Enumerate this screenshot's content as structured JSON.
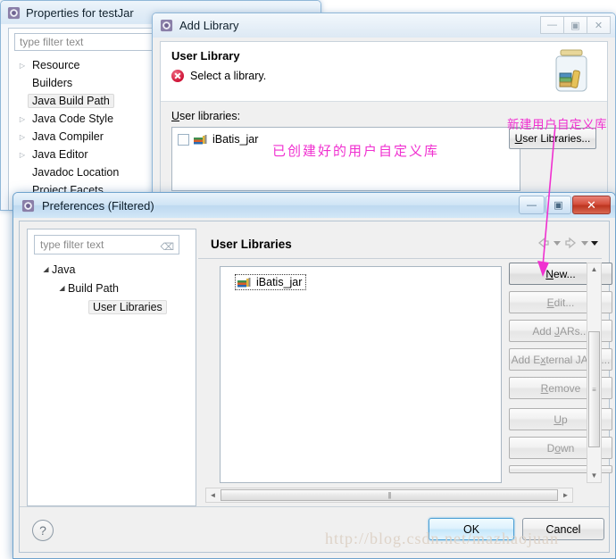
{
  "properties_window": {
    "title": "Properties for testJar",
    "filter_placeholder": "type filter text",
    "tree": [
      {
        "label": "Resource",
        "expandable": true
      },
      {
        "label": "Builders",
        "expandable": false
      },
      {
        "label": "Java Build Path",
        "expandable": false,
        "selected": true
      },
      {
        "label": "Java Code Style",
        "expandable": true
      },
      {
        "label": "Java Compiler",
        "expandable": true
      },
      {
        "label": "Java Editor",
        "expandable": true
      },
      {
        "label": "Javadoc Location",
        "expandable": false
      },
      {
        "label": "Project Facets",
        "expandable": false
      }
    ]
  },
  "add_library_window": {
    "title": "Add Library",
    "heading": "User Library",
    "message": "Select a library.",
    "icon": "library-jar-icon",
    "user_libraries_label": "User libraries:",
    "libraries": [
      {
        "name": "iBatis_jar",
        "checked": false
      }
    ],
    "user_libraries_button": "User Libraries...",
    "window_buttons": [
      "minimize",
      "maximize",
      "close"
    ]
  },
  "preferences_window": {
    "title": "Preferences (Filtered)",
    "filter_placeholder": "type filter text",
    "tree": [
      {
        "label": "Java",
        "level": 0,
        "expanded": true
      },
      {
        "label": "Build Path",
        "level": 1,
        "expanded": true
      },
      {
        "label": "User Libraries",
        "level": 2,
        "selected": true
      }
    ],
    "page_title": "User Libraries",
    "list_items": [
      {
        "label": "iBatis_jar",
        "focused": true
      }
    ],
    "buttons": [
      {
        "label": "New...",
        "enabled": true,
        "mnemonic": "N"
      },
      {
        "label": "Edit...",
        "enabled": false,
        "mnemonic": "E"
      },
      {
        "label": "Add JARs...",
        "enabled": false,
        "mnemonic": "J"
      },
      {
        "label": "Add External JARs...",
        "enabled": false,
        "mnemonic": "x"
      },
      {
        "label": "Remove",
        "enabled": false,
        "mnemonic": "R"
      },
      {
        "label": "Up",
        "enabled": false,
        "mnemonic": "U"
      },
      {
        "label": "Down",
        "enabled": false,
        "mnemonic": "o"
      }
    ],
    "footer": {
      "help": "?",
      "ok": "OK",
      "cancel": "Cancel"
    },
    "window_buttons": [
      "minimize",
      "maximize",
      "close"
    ]
  },
  "annotations": [
    {
      "id": "created-library",
      "text": "已创建好的用户自定义库",
      "color": "#f030d0"
    },
    {
      "id": "new-library",
      "text": "新建用户自定义库",
      "color": "#f030d0"
    }
  ],
  "watermark": "http://blog.csdn.net/mazhaojuan",
  "colors": {
    "annotation": "#f030d0",
    "close_button": "#bd3520",
    "ok_focus": "#4b9fd4"
  }
}
